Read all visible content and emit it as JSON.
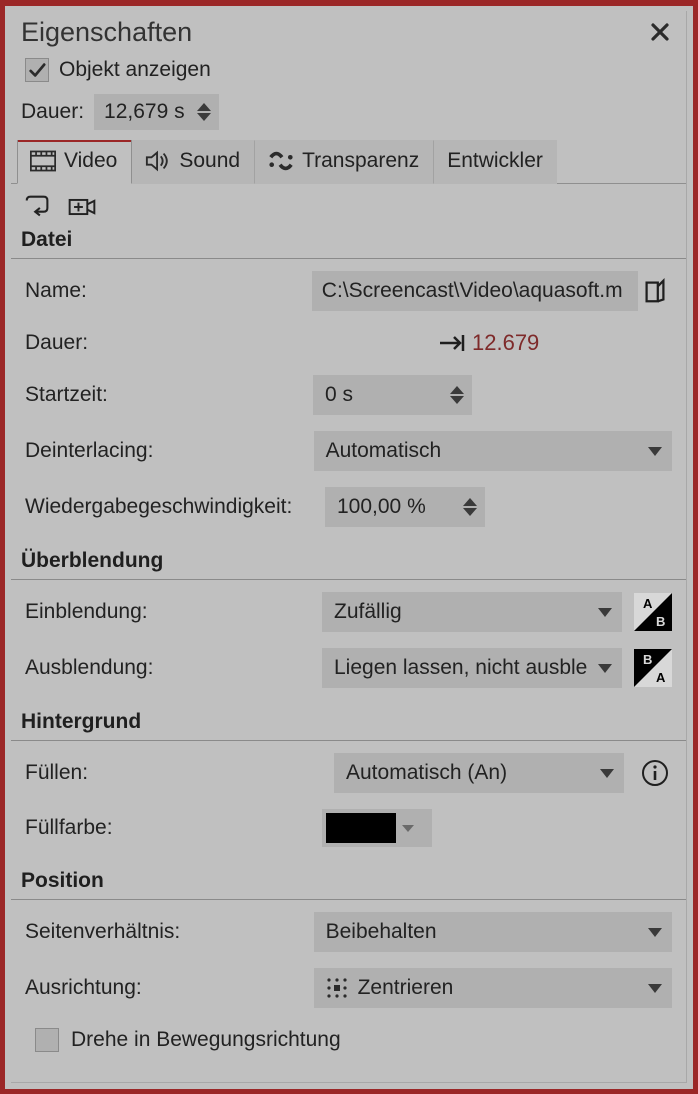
{
  "title": "Eigenschaften",
  "show_object": {
    "label": "Objekt anzeigen",
    "checked": true
  },
  "duration": {
    "label": "Dauer:",
    "value": "12,679 s"
  },
  "tabs": {
    "video": "Video",
    "sound": "Sound",
    "transparency": "Transparenz",
    "developer": "Entwickler"
  },
  "sections": {
    "file": "Datei",
    "transition": "Überblendung",
    "background": "Hintergrund",
    "position": "Position"
  },
  "file": {
    "name_label": "Name:",
    "name_value": "C:\\Screencast\\Video\\aquasoft.m",
    "dur_label": "Dauer:",
    "dur_value": "12.679",
    "start_label": "Startzeit:",
    "start_value": "0 s",
    "deint_label": "Deinterlacing:",
    "deint_value": "Automatisch",
    "speed_label": "Wiedergabegeschwindigkeit:",
    "speed_value": "100,00 %"
  },
  "transition": {
    "in_label": "Einblendung:",
    "in_value": "Zufällig",
    "out_label": "Ausblendung:",
    "out_value": "Liegen lassen, nicht ausble"
  },
  "background": {
    "fill_label": "Füllen:",
    "fill_value": "Automatisch (An)",
    "color_label": "Füllfarbe:",
    "color_value": "#000000"
  },
  "position": {
    "ratio_label": "Seitenverhältnis:",
    "ratio_value": "Beibehalten",
    "align_label": "Ausrichtung:",
    "align_value": "Zentrieren",
    "rotate_label": "Drehe in Bewegungsrichtung",
    "rotate_checked": false
  }
}
